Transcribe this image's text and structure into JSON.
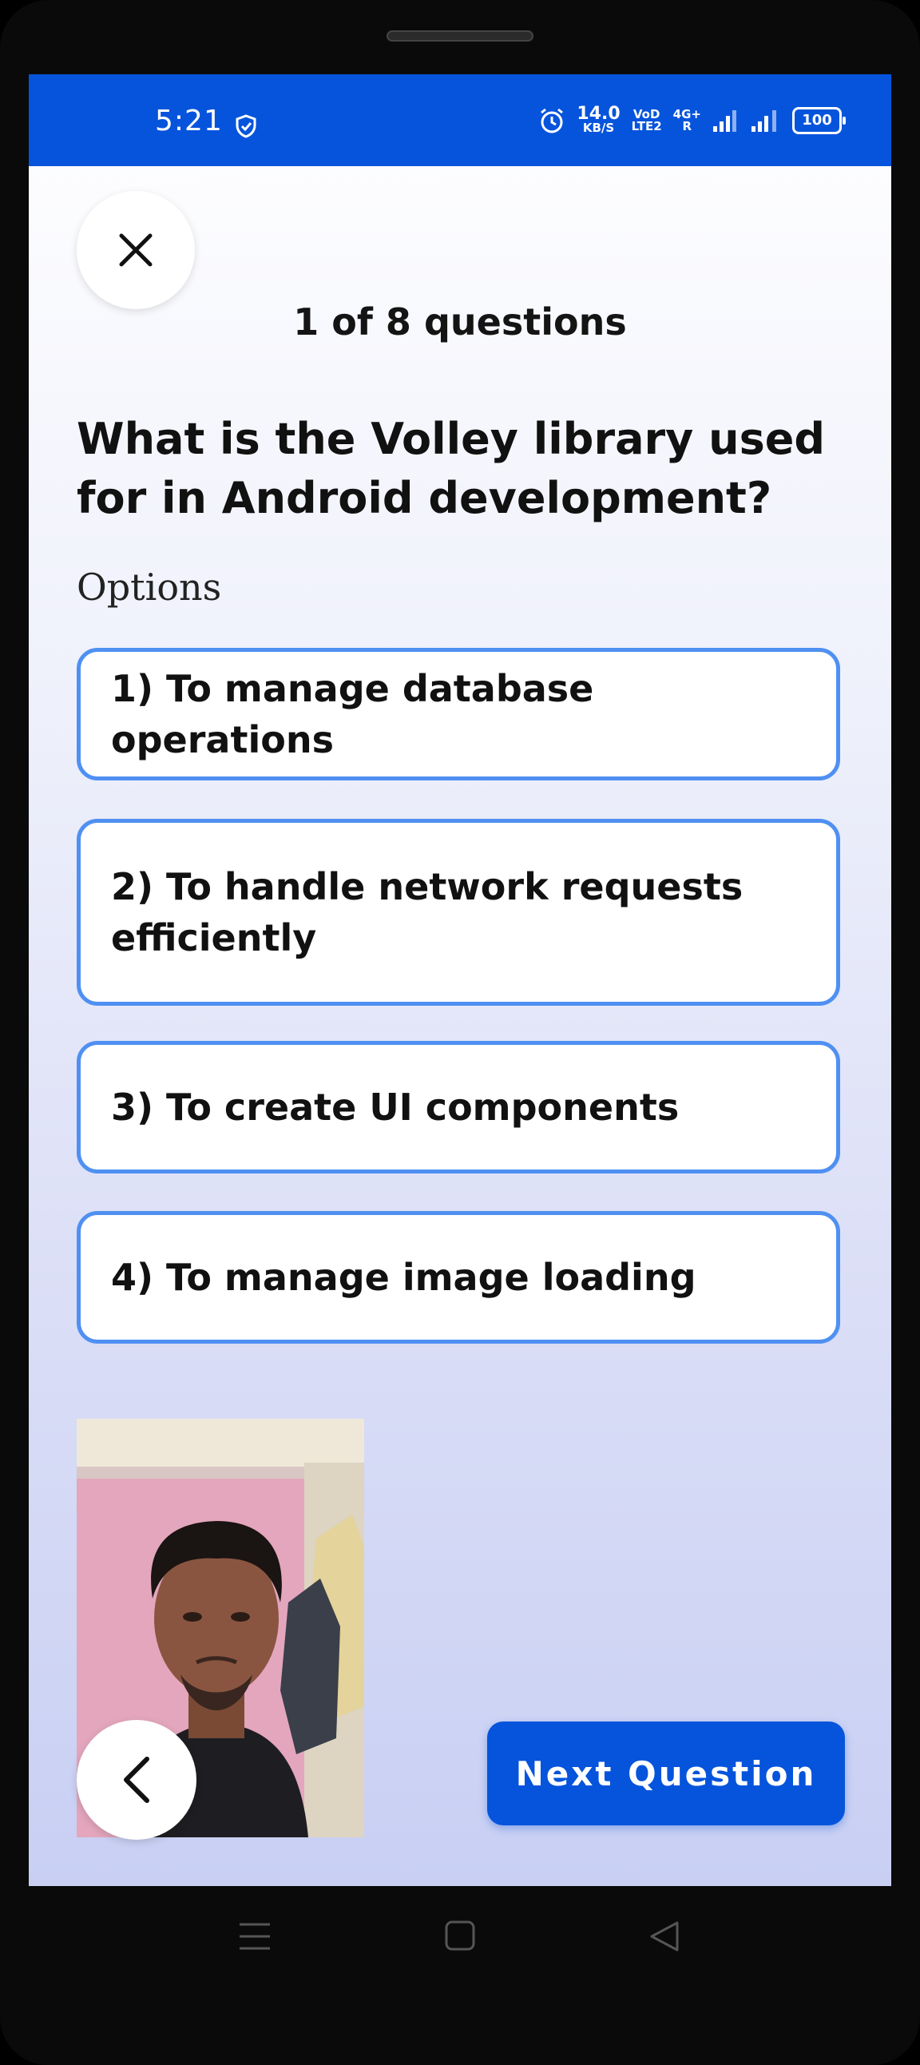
{
  "status_bar": {
    "time": "5:21",
    "net_speed_value": "14.0",
    "net_speed_unit": "KB/S",
    "volte_top": "VoD",
    "volte_bottom": "LTE2",
    "network_top": "4G+",
    "network_bottom": "R",
    "battery": "100",
    "icons": [
      "shield-check-icon",
      "alarm-icon",
      "signal-icon",
      "signal-icon",
      "battery-icon"
    ]
  },
  "quiz": {
    "counter": "1 of 8 questions",
    "question": "What is the Volley library used for in Android development?",
    "options_label": "Options",
    "options": [
      {
        "label": "1) To manage database operations"
      },
      {
        "label": "2) To handle network requests efficiently"
      },
      {
        "label": "3) To create UI components"
      },
      {
        "label": "4) To manage image loading"
      }
    ],
    "next_button": "Next Question"
  },
  "colors": {
    "accent": "#0654dc",
    "option_border": "#4f90f2"
  },
  "icons": {
    "close": "close-icon",
    "back": "chevron-left-icon",
    "nav": [
      "menu-icon",
      "home-square-icon",
      "back-triangle-icon"
    ]
  }
}
